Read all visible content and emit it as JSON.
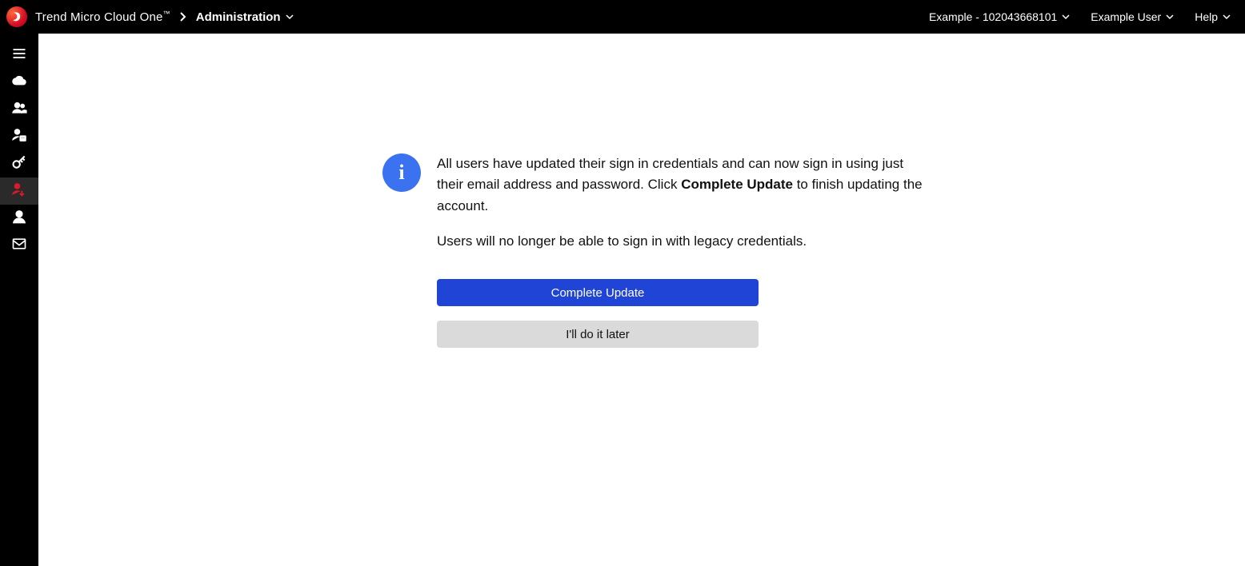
{
  "header": {
    "brand": "Trend Micro Cloud One",
    "brand_tm": "™",
    "section": "Administration",
    "account_label": "Example - 102043668101",
    "user_label": "Example User",
    "help_label": "Help"
  },
  "sidebar": {
    "items": [
      {
        "name": "menu-icon"
      },
      {
        "name": "cloud-icon"
      },
      {
        "name": "users-icon"
      },
      {
        "name": "user-role-icon"
      },
      {
        "name": "key-icon"
      },
      {
        "name": "user-migrate-icon"
      },
      {
        "name": "profile-icon"
      },
      {
        "name": "mail-icon"
      }
    ],
    "active_index": 5
  },
  "notice": {
    "paragraph1_pre": "All users have updated their sign in credentials and can now sign in using just their email address and password. Click ",
    "paragraph1_bold": "Complete Update",
    "paragraph1_post": " to finish updating the account.",
    "paragraph2": "Users will no longer be able to sign in with legacy credentials."
  },
  "actions": {
    "primary": "Complete Update",
    "secondary": "I'll do it later"
  }
}
